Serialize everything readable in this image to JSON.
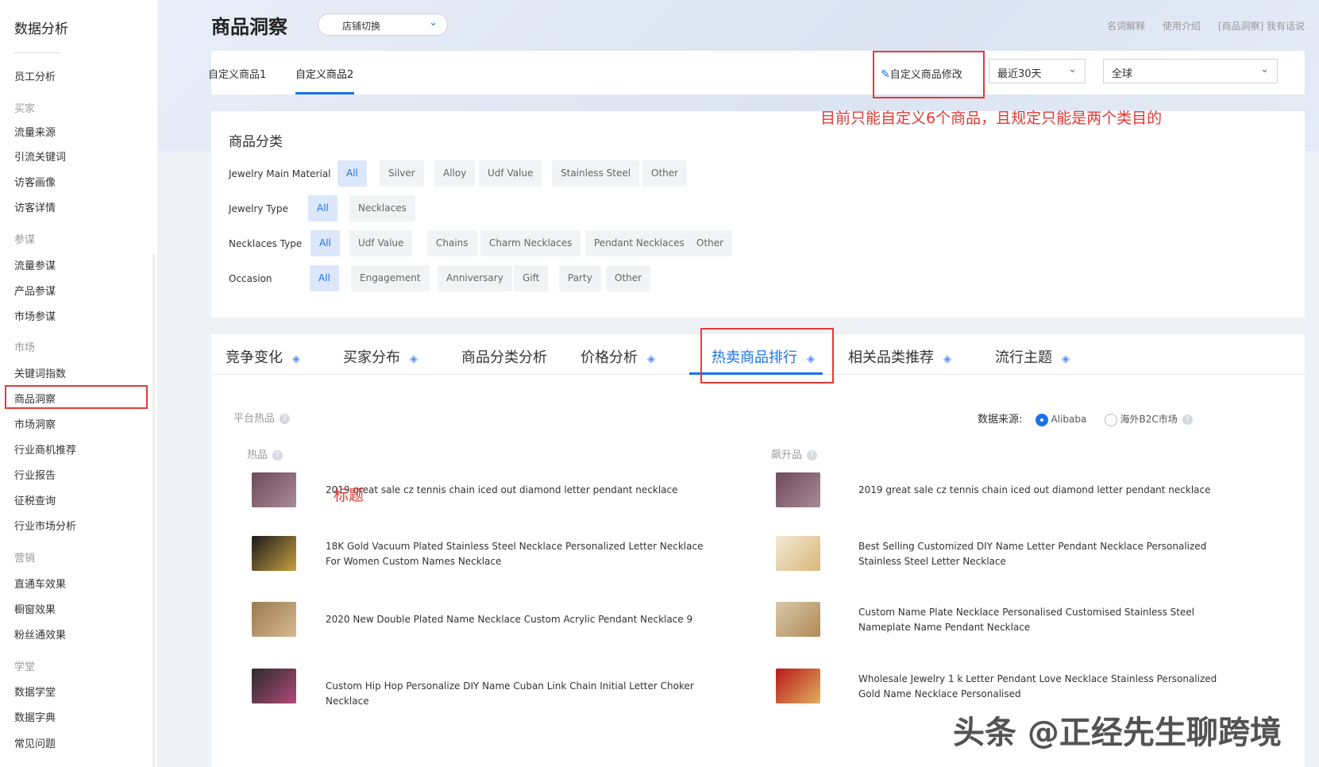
{
  "sidebar": {
    "brand": "数据分析",
    "items": [
      {
        "type": "item",
        "label": "员工分析"
      },
      {
        "type": "group",
        "label": "买家"
      },
      {
        "type": "item",
        "label": "流量来源"
      },
      {
        "type": "item",
        "label": "引流关键词"
      },
      {
        "type": "item",
        "label": "访客画像"
      },
      {
        "type": "item",
        "label": "访客详情"
      },
      {
        "type": "group",
        "label": "参谋"
      },
      {
        "type": "item",
        "label": "流量参谋"
      },
      {
        "type": "item",
        "label": "产品参谋"
      },
      {
        "type": "item",
        "label": "市场参谋"
      },
      {
        "type": "group",
        "label": "市场"
      },
      {
        "type": "item",
        "label": "关键词指数"
      },
      {
        "type": "item",
        "label": "商品洞察",
        "active": true
      },
      {
        "type": "item",
        "label": "市场洞察"
      },
      {
        "type": "item",
        "label": "行业商机推荐"
      },
      {
        "type": "item",
        "label": "行业报告"
      },
      {
        "type": "item",
        "label": "征税查询"
      },
      {
        "type": "item",
        "label": "行业市场分析"
      },
      {
        "type": "group",
        "label": "营销"
      },
      {
        "type": "item",
        "label": "直通车效果"
      },
      {
        "type": "item",
        "label": "橱窗效果"
      },
      {
        "type": "item",
        "label": "粉丝通效果"
      },
      {
        "type": "group",
        "label": "学堂"
      },
      {
        "type": "item",
        "label": "数据学堂"
      },
      {
        "type": "item",
        "label": "数据字典"
      },
      {
        "type": "item",
        "label": "常见问题"
      }
    ]
  },
  "header": {
    "title": "商品洞察",
    "shop_switch": "店铺切换",
    "links": [
      "名词解释",
      "使用介绍",
      "[商品洞察] 我有话说"
    ]
  },
  "product_bar": {
    "tabs": [
      "自定义商品1",
      "自定义商品2"
    ],
    "active_tab": 1,
    "edit_label": "自定义商品修改",
    "period": "最近30天",
    "region": "全球"
  },
  "annotations": {
    "limit_note": "目前只能自定义6个商品，且规定只能是两个类目的",
    "title_note": "标题"
  },
  "category": {
    "title": "商品分类",
    "rows": [
      {
        "label": "Jewelry Main Material",
        "options": [
          "All",
          "Silver",
          "Alloy",
          "Udf Value",
          "Stainless Steel",
          "Other"
        ]
      },
      {
        "label": "Jewelry Type",
        "options": [
          "All",
          "Necklaces"
        ]
      },
      {
        "label": "Necklaces Type",
        "options": [
          "All",
          "Udf Value",
          "Chains",
          "Charm Necklaces",
          "Pendant Necklaces",
          "Other"
        ]
      },
      {
        "label": "Occasion",
        "options": [
          "All",
          "Engagement",
          "Anniversary",
          "Gift",
          "Party",
          "Other"
        ]
      }
    ]
  },
  "main_tabs": [
    "竞争变化",
    "买家分布",
    "商品分类分析",
    "价格分析",
    "热卖商品排行",
    "相关品类推荐",
    "流行主题"
  ],
  "active_main_tab": 4,
  "hot": {
    "platform_label": "平台热品",
    "source_label": "数据来源:",
    "sources": [
      "Alibaba",
      "海外B2C市场"
    ],
    "left_label": "热品",
    "right_label": "飙升品",
    "left_products": [
      "2019 great sale cz tennis chain iced out diamond letter pendant necklace",
      "18K Gold Vacuum Plated Stainless Steel Necklace Personalized Letter Necklace For Women Custom Names Necklace",
      "2020 New Double Plated Name Necklace Custom Acrylic Pendant Necklace 9",
      "Custom Hip Hop Personalize DIY Name Cuban Link Chain Initial Letter Choker Necklace"
    ],
    "right_products": [
      "2019 great sale cz tennis chain iced out diamond letter pendant necklace",
      "Best Selling Customized DIY Name Letter Pendant Necklace Personalized Stainless Steel Letter Necklace",
      "Custom Name Plate Necklace Personalised Customised Stainless Steel Nameplate Name Pendant Necklace",
      "Wholesale Jewelry 1 k Letter Pendant Love Necklace Stainless Personalized Gold Name Necklace Personalised"
    ]
  },
  "watermark": "头条 @正经先生聊跨境",
  "colors": {
    "accent": "#1a73e8",
    "annotation": "#e53935"
  }
}
